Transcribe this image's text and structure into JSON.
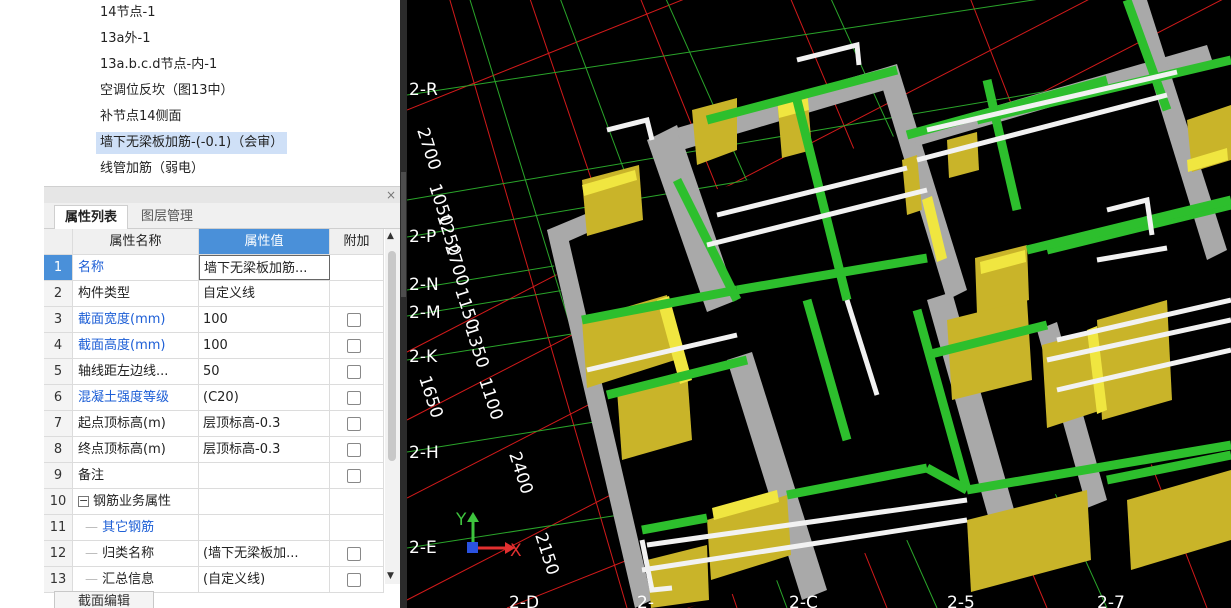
{
  "tree": {
    "items": [
      "14节点-1",
      "13a外-1",
      "13a.b.c.d节点-内-1",
      "空调位反坎（图13中）",
      "补节点14侧面",
      "墙下无梁板加筋-(-0.1)（会审）",
      "线管加筋（弱电）"
    ],
    "selected_index": 5
  },
  "property_panel": {
    "close_glyph": "×",
    "tabs": [
      "属性列表",
      "图层管理"
    ],
    "headers": {
      "name": "属性名称",
      "value": "属性值",
      "extra": "附加"
    },
    "rows": [
      {
        "num": "1",
        "name": "名称",
        "value": "墙下无梁板加筋...",
        "blue": true,
        "checkbox": false
      },
      {
        "num": "2",
        "name": "构件类型",
        "value": "自定义线",
        "blue": false,
        "checkbox": false
      },
      {
        "num": "3",
        "name": "截面宽度(mm)",
        "value": "100",
        "blue": true,
        "checkbox": true
      },
      {
        "num": "4",
        "name": "截面高度(mm)",
        "value": "100",
        "blue": true,
        "checkbox": true
      },
      {
        "num": "5",
        "name": "轴线距左边线...",
        "value": "50",
        "blue": false,
        "checkbox": true
      },
      {
        "num": "6",
        "name": "混凝土强度等级",
        "value": "(C20)",
        "blue": true,
        "checkbox": true
      },
      {
        "num": "7",
        "name": "起点顶标高(m)",
        "value": "层顶标高-0.3",
        "blue": false,
        "checkbox": true
      },
      {
        "num": "8",
        "name": "终点顶标高(m)",
        "value": "层顶标高-0.3",
        "blue": false,
        "checkbox": true
      },
      {
        "num": "9",
        "name": "备注",
        "value": "",
        "blue": false,
        "checkbox": true
      },
      {
        "num": "10",
        "name": "钢筋业务属性",
        "value": "",
        "blue": false,
        "checkbox": false
      },
      {
        "num": "11",
        "name": "其它钢筋",
        "value": "",
        "blue": true,
        "checkbox": false
      },
      {
        "num": "12",
        "name": "归类名称",
        "value": "(墙下无梁板加...",
        "blue": false,
        "checkbox": true
      },
      {
        "num": "13",
        "name": "汇总信息",
        "value": "(自定义线)",
        "blue": false,
        "checkbox": true
      }
    ],
    "expander_glyph": "−",
    "bottom_button": "截面编辑"
  },
  "viewport": {
    "axis_labels": [
      "2-R",
      "2-P",
      "2-N",
      "2-M",
      "2-K",
      "2-H",
      "2-E",
      "2-D",
      "2-",
      "2-C",
      "2-5",
      "2-7"
    ],
    "dimension_labels": [
      "2700",
      "1050",
      "1250",
      "2700",
      "1150",
      "1350",
      "1100",
      "1650",
      "2400",
      "2150"
    ],
    "gizmo": {
      "x": "X",
      "y": "Y"
    },
    "colors": {
      "background": "#000000",
      "grid_red": "#d11a1a",
      "grid_green": "#2aa52a",
      "wall_gray": "#a9a9a9",
      "wall_yellow": "#c9b429",
      "beam_green": "#2dbf2d",
      "beam_white": "#f2f2f2",
      "accent_yellow": "#f0e640"
    }
  }
}
